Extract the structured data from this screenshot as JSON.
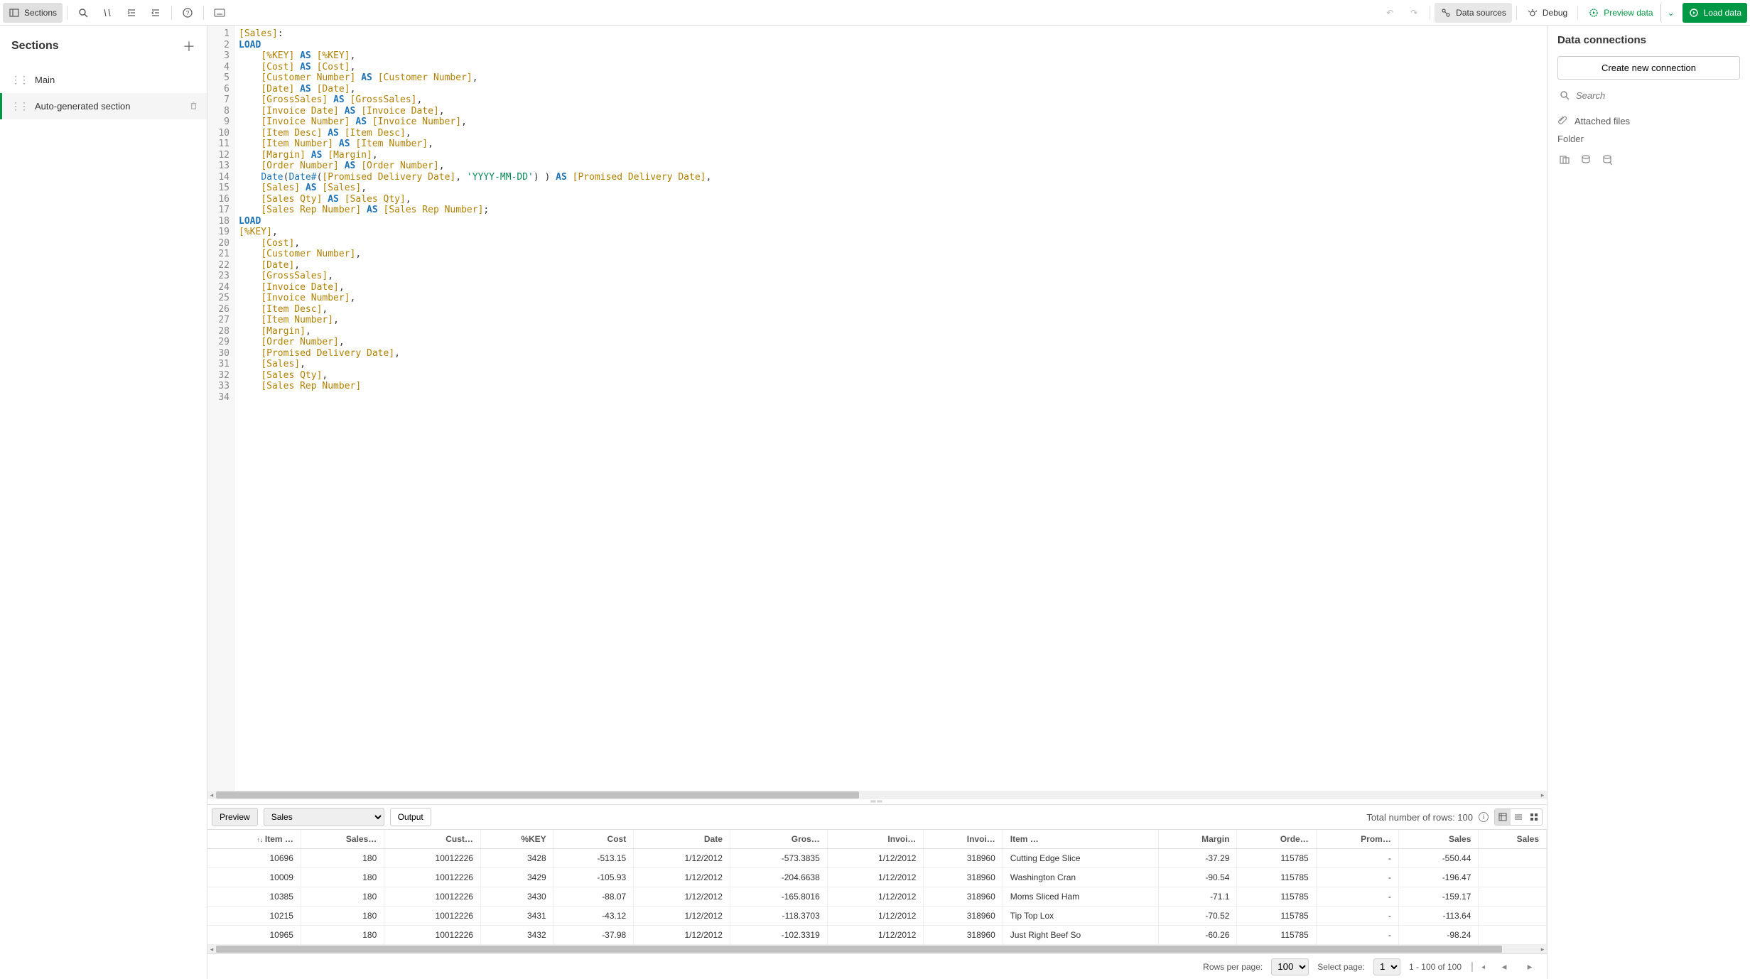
{
  "toolbar": {
    "sections_label": "Sections",
    "data_sources_label": "Data sources",
    "debug_label": "Debug",
    "preview_data_label": "Preview data",
    "load_data_label": "Load data"
  },
  "sections_panel": {
    "title": "Sections",
    "items": [
      {
        "label": "Main"
      },
      {
        "label": "Auto-generated section"
      }
    ]
  },
  "editor": {
    "line_count": 34,
    "tokens": [
      [
        [
          "fld",
          "[Sales]"
        ],
        [
          "punct",
          ":"
        ]
      ],
      [
        [
          "kw",
          "LOAD"
        ]
      ],
      [
        [
          "punct",
          "    "
        ],
        [
          "fld",
          "[%KEY]"
        ],
        [
          "punct",
          " "
        ],
        [
          "kw",
          "AS"
        ],
        [
          "punct",
          " "
        ],
        [
          "fld",
          "[%KEY]"
        ],
        [
          "punct",
          ","
        ]
      ],
      [
        [
          "punct",
          "    "
        ],
        [
          "fld",
          "[Cost]"
        ],
        [
          "punct",
          " "
        ],
        [
          "kw",
          "AS"
        ],
        [
          "punct",
          " "
        ],
        [
          "fld",
          "[Cost]"
        ],
        [
          "punct",
          ","
        ]
      ],
      [
        [
          "punct",
          "    "
        ],
        [
          "fld",
          "[Customer Number]"
        ],
        [
          "punct",
          " "
        ],
        [
          "kw",
          "AS"
        ],
        [
          "punct",
          " "
        ],
        [
          "fld",
          "[Customer Number]"
        ],
        [
          "punct",
          ","
        ]
      ],
      [
        [
          "punct",
          "    "
        ],
        [
          "fld",
          "[Date]"
        ],
        [
          "punct",
          " "
        ],
        [
          "kw",
          "AS"
        ],
        [
          "punct",
          " "
        ],
        [
          "fld",
          "[Date]"
        ],
        [
          "punct",
          ","
        ]
      ],
      [
        [
          "punct",
          "    "
        ],
        [
          "fld",
          "[GrossSales]"
        ],
        [
          "punct",
          " "
        ],
        [
          "kw",
          "AS"
        ],
        [
          "punct",
          " "
        ],
        [
          "fld",
          "[GrossSales]"
        ],
        [
          "punct",
          ","
        ]
      ],
      [
        [
          "punct",
          "    "
        ],
        [
          "fld",
          "[Invoice Date]"
        ],
        [
          "punct",
          " "
        ],
        [
          "kw",
          "AS"
        ],
        [
          "punct",
          " "
        ],
        [
          "fld",
          "[Invoice Date]"
        ],
        [
          "punct",
          ","
        ]
      ],
      [
        [
          "punct",
          "    "
        ],
        [
          "fld",
          "[Invoice Number]"
        ],
        [
          "punct",
          " "
        ],
        [
          "kw",
          "AS"
        ],
        [
          "punct",
          " "
        ],
        [
          "fld",
          "[Invoice Number]"
        ],
        [
          "punct",
          ","
        ]
      ],
      [
        [
          "punct",
          "    "
        ],
        [
          "fld",
          "[Item Desc]"
        ],
        [
          "punct",
          " "
        ],
        [
          "kw",
          "AS"
        ],
        [
          "punct",
          " "
        ],
        [
          "fld",
          "[Item Desc]"
        ],
        [
          "punct",
          ","
        ]
      ],
      [
        [
          "punct",
          "    "
        ],
        [
          "fld",
          "[Item Number]"
        ],
        [
          "punct",
          " "
        ],
        [
          "kw",
          "AS"
        ],
        [
          "punct",
          " "
        ],
        [
          "fld",
          "[Item Number]"
        ],
        [
          "punct",
          ","
        ]
      ],
      [
        [
          "punct",
          "    "
        ],
        [
          "fld",
          "[Margin]"
        ],
        [
          "punct",
          " "
        ],
        [
          "kw",
          "AS"
        ],
        [
          "punct",
          " "
        ],
        [
          "fld",
          "[Margin]"
        ],
        [
          "punct",
          ","
        ]
      ],
      [
        [
          "punct",
          "    "
        ],
        [
          "fld",
          "[Order Number]"
        ],
        [
          "punct",
          " "
        ],
        [
          "kw",
          "AS"
        ],
        [
          "punct",
          " "
        ],
        [
          "fld",
          "[Order Number]"
        ],
        [
          "punct",
          ","
        ]
      ],
      [
        [
          "punct",
          "    "
        ],
        [
          "fn",
          "Date"
        ],
        [
          "punct",
          "("
        ],
        [
          "fn",
          "Date#"
        ],
        [
          "punct",
          "("
        ],
        [
          "fld",
          "[Promised Delivery Date]"
        ],
        [
          "punct",
          ", "
        ],
        [
          "str",
          "'YYYY-MM-DD'"
        ],
        [
          "punct",
          ") ) "
        ],
        [
          "kw",
          "AS"
        ],
        [
          "punct",
          " "
        ],
        [
          "fld",
          "[Promised Delivery Date]"
        ],
        [
          "punct",
          ","
        ]
      ],
      [
        [
          "punct",
          "    "
        ],
        [
          "fld",
          "[Sales]"
        ],
        [
          "punct",
          " "
        ],
        [
          "kw",
          "AS"
        ],
        [
          "punct",
          " "
        ],
        [
          "fld",
          "[Sales]"
        ],
        [
          "punct",
          ","
        ]
      ],
      [
        [
          "punct",
          "    "
        ],
        [
          "fld",
          "[Sales Qty]"
        ],
        [
          "punct",
          " "
        ],
        [
          "kw",
          "AS"
        ],
        [
          "punct",
          " "
        ],
        [
          "fld",
          "[Sales Qty]"
        ],
        [
          "punct",
          ","
        ]
      ],
      [
        [
          "punct",
          "    "
        ],
        [
          "fld",
          "[Sales Rep Number]"
        ],
        [
          "punct",
          " "
        ],
        [
          "kw",
          "AS"
        ],
        [
          "punct",
          " "
        ],
        [
          "fld",
          "[Sales Rep Number]"
        ],
        [
          "punct",
          ";"
        ]
      ],
      [
        [
          "kw",
          "LOAD"
        ]
      ],
      [
        [
          "fld",
          "[%KEY]"
        ],
        [
          "punct",
          ","
        ]
      ],
      [
        [
          "punct",
          "    "
        ],
        [
          "fld",
          "[Cost]"
        ],
        [
          "punct",
          ","
        ]
      ],
      [
        [
          "punct",
          "    "
        ],
        [
          "fld",
          "[Customer Number]"
        ],
        [
          "punct",
          ","
        ]
      ],
      [
        [
          "punct",
          "    "
        ],
        [
          "fld",
          "[Date]"
        ],
        [
          "punct",
          ","
        ]
      ],
      [
        [
          "punct",
          "    "
        ],
        [
          "fld",
          "[GrossSales]"
        ],
        [
          "punct",
          ","
        ]
      ],
      [
        [
          "punct",
          "    "
        ],
        [
          "fld",
          "[Invoice Date]"
        ],
        [
          "punct",
          ","
        ]
      ],
      [
        [
          "punct",
          "    "
        ],
        [
          "fld",
          "[Invoice Number]"
        ],
        [
          "punct",
          ","
        ]
      ],
      [
        [
          "punct",
          "    "
        ],
        [
          "fld",
          "[Item Desc]"
        ],
        [
          "punct",
          ","
        ]
      ],
      [
        [
          "punct",
          "    "
        ],
        [
          "fld",
          "[Item Number]"
        ],
        [
          "punct",
          ","
        ]
      ],
      [
        [
          "punct",
          "    "
        ],
        [
          "fld",
          "[Margin]"
        ],
        [
          "punct",
          ","
        ]
      ],
      [
        [
          "punct",
          "    "
        ],
        [
          "fld",
          "[Order Number]"
        ],
        [
          "punct",
          ","
        ]
      ],
      [
        [
          "punct",
          "    "
        ],
        [
          "fld",
          "[Promised Delivery Date]"
        ],
        [
          "punct",
          ","
        ]
      ],
      [
        [
          "punct",
          "    "
        ],
        [
          "fld",
          "[Sales]"
        ],
        [
          "punct",
          ","
        ]
      ],
      [
        [
          "punct",
          "    "
        ],
        [
          "fld",
          "[Sales Qty]"
        ],
        [
          "punct",
          ","
        ]
      ],
      [
        [
          "punct",
          "    "
        ],
        [
          "fld",
          "[Sales Rep Number]"
        ]
      ],
      [
        [
          "punct",
          ""
        ]
      ]
    ]
  },
  "preview_bar": {
    "preview_btn": "Preview",
    "table_select": "Sales",
    "output_btn": "Output",
    "total_rows_label": "Total number of rows: 100"
  },
  "table": {
    "columns": [
      "Item …",
      "Sales…",
      "Cust…",
      "%KEY",
      "Cost",
      "Date",
      "Gros…",
      "Invoi…",
      "Invoi…",
      "Item …",
      "Margin",
      "Orde…",
      "Prom…",
      "Sales",
      "Sales"
    ],
    "rows": [
      [
        "10696",
        "180",
        "10012226",
        "3428",
        "-513.15",
        "1/12/2012",
        "-573.3835",
        "1/12/2012",
        "318960",
        "Cutting Edge Slice",
        "-37.29",
        "115785",
        "-",
        "-550.44",
        ""
      ],
      [
        "10009",
        "180",
        "10012226",
        "3429",
        "-105.93",
        "1/12/2012",
        "-204.6638",
        "1/12/2012",
        "318960",
        "Washington Cran",
        "-90.54",
        "115785",
        "-",
        "-196.47",
        ""
      ],
      [
        "10385",
        "180",
        "10012226",
        "3430",
        "-88.07",
        "1/12/2012",
        "-165.8016",
        "1/12/2012",
        "318960",
        "Moms Sliced Ham",
        "-71.1",
        "115785",
        "-",
        "-159.17",
        ""
      ],
      [
        "10215",
        "180",
        "10012226",
        "3431",
        "-43.12",
        "1/12/2012",
        "-118.3703",
        "1/12/2012",
        "318960",
        "Tip Top Lox",
        "-70.52",
        "115785",
        "-",
        "-113.64",
        ""
      ],
      [
        "10965",
        "180",
        "10012226",
        "3432",
        "-37.98",
        "1/12/2012",
        "-102.3319",
        "1/12/2012",
        "318960",
        "Just Right Beef So",
        "-60.26",
        "115785",
        "-",
        "-98.24",
        ""
      ]
    ]
  },
  "pager": {
    "rows_per_page_label": "Rows per page:",
    "rows_per_page_value": "100",
    "select_page_label": "Select page:",
    "select_page_value": "1",
    "range_label": "1 - 100 of 100"
  },
  "connections": {
    "title": "Data connections",
    "create_btn": "Create new connection",
    "search_placeholder": "Search",
    "attached_label": "Attached files",
    "folder_label": "Folder"
  }
}
